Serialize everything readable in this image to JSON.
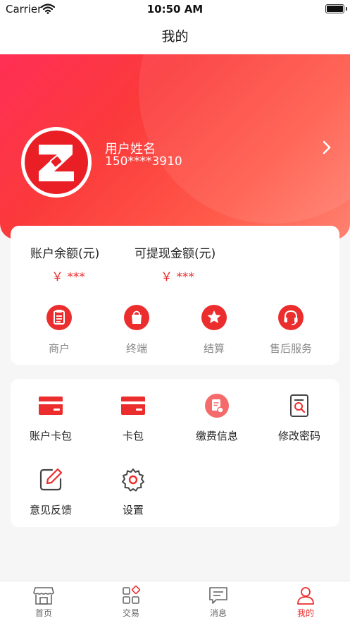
{
  "status_bar": {
    "carrier": "Carrier",
    "time": "10:50 AM"
  },
  "nav": {
    "title": "我的"
  },
  "profile": {
    "name": "用户姓名",
    "phone": "150****3910"
  },
  "balances": [
    {
      "label": "账户余额(元)",
      "value": "￥ ***"
    },
    {
      "label": "可提现金额(元)",
      "value": "￥ ***"
    }
  ],
  "quick_actions": [
    {
      "label": "商户",
      "icon": "clipboard-icon"
    },
    {
      "label": "终端",
      "icon": "shopping-bag-icon"
    },
    {
      "label": "结算",
      "icon": "star-icon"
    },
    {
      "label": "售后服务",
      "icon": "headset-icon"
    }
  ],
  "menu": [
    {
      "label": "账户卡包",
      "icon": "card-icon"
    },
    {
      "label": "卡包",
      "icon": "card-icon"
    },
    {
      "label": "缴费信息",
      "icon": "bill-icon"
    },
    {
      "label": "修改密码",
      "icon": "document-search-icon"
    },
    {
      "label": "意见反馈",
      "icon": "edit-icon"
    },
    {
      "label": "设置",
      "icon": "gear-icon"
    }
  ],
  "tabs": [
    {
      "label": "首页",
      "icon": "store-icon",
      "active": false
    },
    {
      "label": "交易",
      "icon": "grid-icon",
      "active": false
    },
    {
      "label": "消息",
      "icon": "message-icon",
      "active": false
    },
    {
      "label": "我的",
      "icon": "user-icon",
      "active": true
    }
  ],
  "colors": {
    "accent": "#ec2d2d",
    "hero_start": "#ff2f55",
    "hero_end": "#ff8270"
  }
}
